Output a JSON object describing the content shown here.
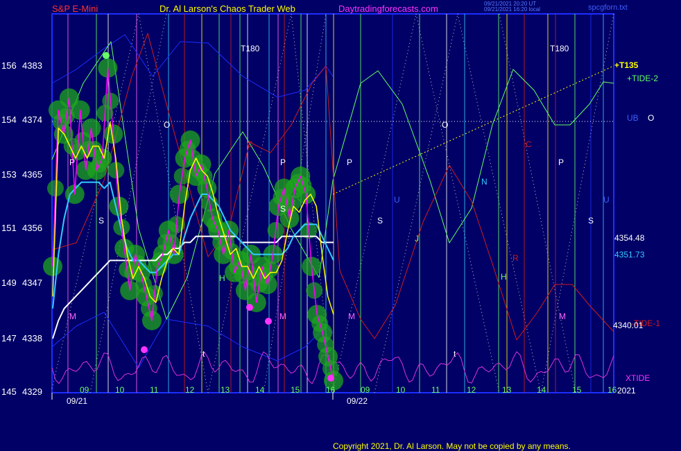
{
  "header": {
    "symbol": "S&P E-Mini",
    "site_title": "Dr. Al Larson's Chaos Trader Web",
    "site_url": "Daytradingforecasts.com",
    "timestamp_1": "09/21/2021 20:20 UT",
    "timestamp_2": "09/21/2021 16:20 local",
    "stamp": "spcgforn.txt"
  },
  "footer": {
    "copyright": "Copyright 2021, Dr. Al Larson. May not be copied by any means."
  },
  "colors": {
    "background": "#000066",
    "price_bars": "#ff00ff",
    "cloud": "#1ea51e",
    "fast_avg": "#ffff00",
    "mid_avg": "#33ccff",
    "slow_avg": "#ffffff",
    "xtide": "#dd33dd",
    "tide_plus2": "#66ff66",
    "tide_minus1": "#d01c1c",
    "bands": "#1c2eff"
  },
  "chart_data": {
    "type": "line",
    "title": "S&P E-Mini",
    "x": {
      "hour_ticks": [
        "09",
        "10",
        "11",
        "12",
        "13",
        "14",
        "15",
        "16",
        "09",
        "10",
        "11",
        "12",
        "13",
        "14",
        "15",
        "16"
      ],
      "dates": [
        "09/21",
        "09/22"
      ]
    },
    "y": {
      "range": [
        4329,
        4392
      ],
      "ticks": [
        {
          "left": "145",
          "price": 4329
        },
        {
          "left": "147",
          "price": 4338
        },
        {
          "left": "149",
          "price": 4347
        },
        {
          "left": "151",
          "price": 4356
        },
        {
          "left": "153",
          "price": 4365
        },
        {
          "left": "154",
          "price": 4374
        },
        {
          "left": "156",
          "price": 4383
        }
      ]
    },
    "levels": [
      {
        "label": "4354.48",
        "value": 4354.48,
        "color": "#ffffff"
      },
      {
        "label": "4351.73",
        "value": 4351.73,
        "color": "#33ccff"
      },
      {
        "label": "4340.01",
        "value": 4340.01,
        "color": "#ffffff"
      }
    ],
    "series": [
      {
        "name": "+T135",
        "color": "#ffff00"
      },
      {
        "name": "+TIDE-2",
        "color": "#66ff66"
      },
      {
        "name": "UB",
        "color": "#1c2eff"
      },
      {
        "name": "O",
        "color": "#ffffff"
      },
      {
        "name": "-TIDE-1",
        "color": "#d01c1c"
      },
      {
        "name": "XTIDE",
        "color": "#dd33dd"
      },
      {
        "name": "2021",
        "color": "#ffffff"
      }
    ],
    "annotations": [
      "T180",
      "T180",
      "O",
      "O",
      "P",
      "P",
      "P",
      "P",
      "S",
      "S",
      "S",
      "S",
      "H",
      "H",
      "M",
      "M",
      "M",
      "M",
      "C",
      "C",
      "N",
      "R",
      "J",
      "U",
      "U",
      "t",
      "t"
    ],
    "price_path": [
      4350,
      4376,
      4372,
      4378,
      4362,
      4376,
      4366,
      4373,
      4366,
      4368,
      4383,
      4372,
      4360,
      4353,
      4346,
      4352,
      4349,
      4345,
      4341,
      4350,
      4352,
      4356,
      4352,
      4362,
      4368,
      4371,
      4365,
      4367,
      4363,
      4358,
      4356,
      4352,
      4356,
      4349,
      4351,
      4346,
      4352,
      4344,
      4350,
      4347,
      4352,
      4360,
      4363,
      4358,
      4363,
      4365,
      4362,
      4350,
      4342,
      4339,
      4335,
      4331
    ],
    "fast_avg": [
      4345,
      4373,
      4372,
      4370,
      4368,
      4370,
      4368,
      4370,
      4370,
      4368,
      4374,
      4368,
      4358,
      4352,
      4348,
      4350,
      4348,
      4345,
      4344,
      4348,
      4351,
      4353,
      4352,
      4360,
      4366,
      4368,
      4366,
      4365,
      4362,
      4358,
      4355,
      4352,
      4353,
      4350,
      4350,
      4348,
      4350,
      4348,
      4349,
      4349,
      4351,
      4356,
      4360,
      4359,
      4361,
      4362,
      4360,
      4352,
      4345,
      4342
    ],
    "mid_avg": [
      4343,
      4352,
      4358,
      4362,
      4363,
      4364,
      4364,
      4364,
      4364,
      4363,
      4364,
      4360,
      4356,
      4353,
      4351,
      4351,
      4350,
      4349,
      4349,
      4350,
      4351,
      4352,
      4352,
      4355,
      4358,
      4360,
      4362,
      4362,
      4361,
      4360,
      4358,
      4356,
      4355,
      4354,
      4353,
      4352,
      4352,
      4352,
      4352,
      4352,
      4352,
      4353,
      4355,
      4356,
      4357,
      4357,
      4357,
      4355,
      4353,
      4351
    ],
    "slow_avg": [
      4338,
      4341,
      4343,
      4344,
      4345,
      4346,
      4347,
      4348,
      4349,
      4350,
      4351,
      4351,
      4351,
      4351,
      4351,
      4351,
      4351,
      4351,
      4351,
      4352,
      4352,
      4353,
      4353,
      4354,
      4354,
      4355,
      4355,
      4355,
      4355,
      4355,
      4355,
      4355,
      4355,
      4354,
      4354,
      4354,
      4354,
      4354,
      4354,
      4354,
      4355,
      4355,
      4355,
      4355,
      4355,
      4355,
      4355,
      4354,
      4354,
      4354
    ]
  }
}
